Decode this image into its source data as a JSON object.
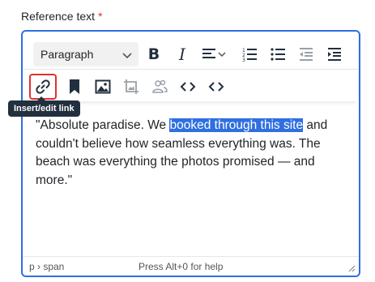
{
  "field": {
    "label": "Reference text",
    "required_mark": "*"
  },
  "toolbar": {
    "block_format": "Paragraph",
    "bold_label": "B",
    "italic_label": "I"
  },
  "tooltip": {
    "text": "Insert/edit link"
  },
  "content": {
    "before": "\"Absolute paradise. We ",
    "selected": "booked through this site",
    "after": " and couldn't believe how seamless everything was. The beach was everything the photos promised — and more.\""
  },
  "statusbar": {
    "path": "p › span",
    "help": "Press Alt+0 for help"
  },
  "colors": {
    "focus_border": "#2f6fe0",
    "selection": "#2f6fe0",
    "active_button": "#e0312e",
    "required": "#d6323a"
  }
}
